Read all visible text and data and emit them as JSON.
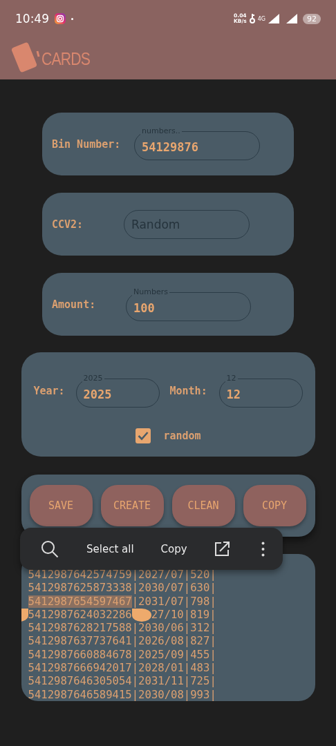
{
  "status_bar": {
    "time": "10:49",
    "net_speed": "0.04",
    "net_unit": "KB/s",
    "network": "4G",
    "battery": "92"
  },
  "app_bar": {
    "logo_text": "CARDS"
  },
  "fields": [
    {
      "label": "Bin Number:",
      "hint": "numbers..",
      "value": "54129876"
    },
    {
      "label": "CCV2:",
      "placeholder": "Random"
    },
    {
      "label": "Amount:",
      "hint": "Numbers",
      "value": "100"
    }
  ],
  "date": {
    "year": {
      "label": "Year:",
      "hint": "2025",
      "value": "2025"
    },
    "month": {
      "label": "Month:",
      "hint": "12",
      "value": "12"
    },
    "random": {
      "label": "random",
      "checked": true
    }
  },
  "buttons": [
    "SAVE",
    "CREATE",
    "CLEAN",
    "COPY"
  ],
  "context_menu": {
    "actions": [
      "Select all",
      "Copy"
    ]
  },
  "output": {
    "lines": [
      {
        "card": "5412987642574759",
        "details": "|2027/07|520|",
        "selected": false
      },
      {
        "card": "5412987625873338",
        "details": "|2030/07|630|",
        "selected": false
      },
      {
        "card": "5412987654597467",
        "details": "|2031/07|798|",
        "selected": true
      },
      {
        "card": "5412987624032286",
        "details": "27/10|819|",
        "selected": false
      },
      {
        "card": "5412987628217588",
        "details": "|2030/06|312|",
        "selected": false
      },
      {
        "card": "5412987637737641",
        "details": "|2026/08|827|",
        "selected": false
      },
      {
        "card": "5412987660884678",
        "details": "|2025/09|455|",
        "selected": false
      },
      {
        "card": "5412987666942017",
        "details": "|2028/01|483|",
        "selected": false
      },
      {
        "card": "5412987646305054",
        "details": "|2031/11|725|",
        "selected": false
      },
      {
        "card": "5412987646589415",
        "details": "|2030/08|993|",
        "selected": false
      }
    ]
  }
}
